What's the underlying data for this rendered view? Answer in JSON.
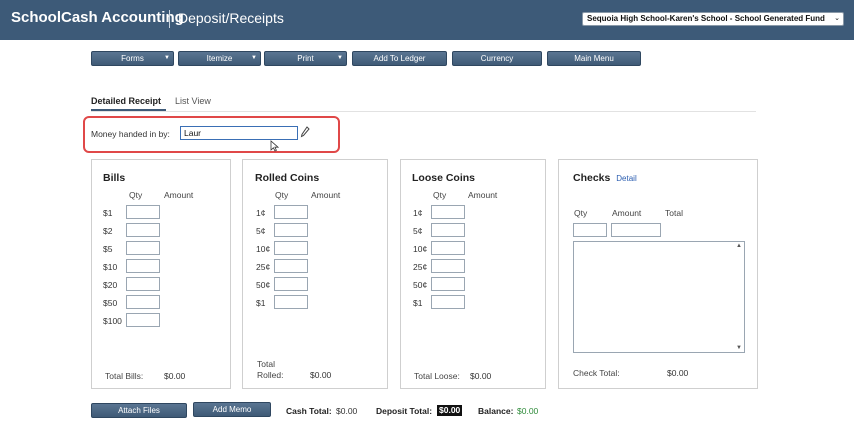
{
  "header": {
    "app_title": "SchoolCash Accounting",
    "page_title": "Deposit/Receipts",
    "school_select": "Sequoia High School-Karen's School - School Generated Fund"
  },
  "toolbar": {
    "forms": "Forms",
    "itemize": "Itemize",
    "print": "Print",
    "add_to_ledger": "Add To Ledger",
    "currency": "Currency",
    "main_menu": "Main Menu"
  },
  "tabs": {
    "detailed": "Detailed Receipt",
    "list": "List View"
  },
  "money_handed": {
    "label": "Money handed in by:",
    "value": "Laur"
  },
  "bills": {
    "title": "Bills",
    "qty_head": "Qty",
    "amount_head": "Amount",
    "rows": [
      "$1",
      "$2",
      "$5",
      "$10",
      "$20",
      "$50",
      "$100"
    ],
    "total_label": "Total Bills:",
    "total_value": "$0.00"
  },
  "rolled": {
    "title": "Rolled Coins",
    "qty_head": "Qty",
    "amount_head": "Amount",
    "rows": [
      "1¢",
      "5¢",
      "10¢",
      "25¢",
      "50¢",
      "$1"
    ],
    "total_label_1": "Total",
    "total_label_2": "Rolled:",
    "total_value": "$0.00"
  },
  "loose": {
    "title": "Loose Coins",
    "qty_head": "Qty",
    "amount_head": "Amount",
    "rows": [
      "1¢",
      "5¢",
      "10¢",
      "25¢",
      "50¢",
      "$1"
    ],
    "total_label": "Total Loose:",
    "total_value": "$0.00"
  },
  "checks": {
    "title": "Checks",
    "detail_link": "Detail",
    "qty_head": "Qty",
    "amount_head": "Amount",
    "total_head": "Total",
    "total_label": "Check Total:",
    "total_value": "$0.00"
  },
  "footer": {
    "attach_files": "Attach Files",
    "add_memo": "Add Memo",
    "cash_total_label": "Cash Total:",
    "cash_total_value": "$0.00",
    "deposit_total_label": "Deposit Total:",
    "deposit_total_value": "$0.00",
    "balance_label": "Balance:",
    "balance_value": "$0.00"
  }
}
